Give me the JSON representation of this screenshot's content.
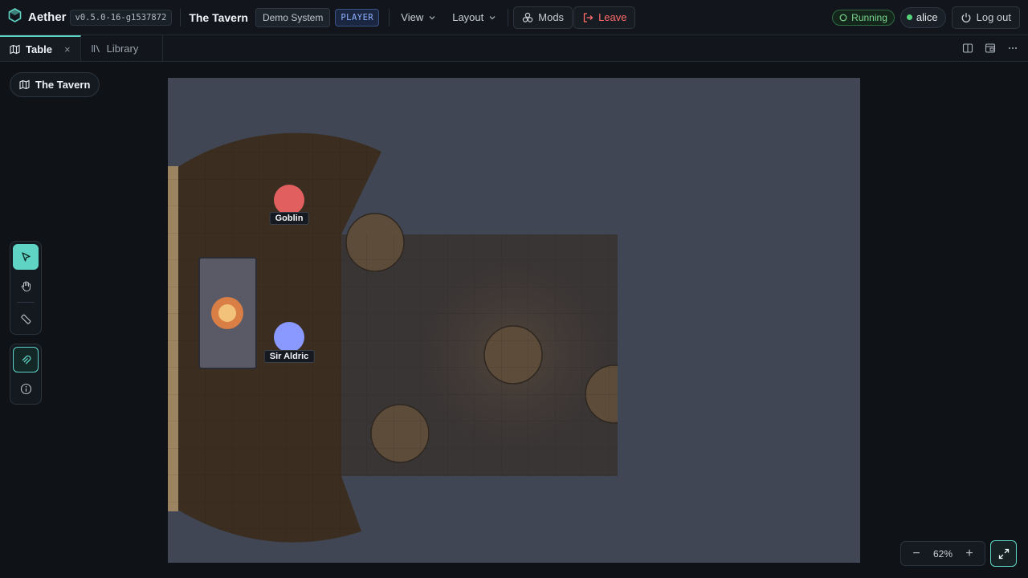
{
  "header": {
    "brand": "Aether",
    "version": "v0.5.0-16-g1537872",
    "table_name": "The Tavern",
    "system": "Demo System",
    "role": "PLAYER",
    "menus": {
      "view": "View",
      "layout": "Layout"
    },
    "mods": "Mods",
    "leave": "Leave",
    "status": "Running",
    "user": "alice",
    "logout": "Log out"
  },
  "tabs": [
    {
      "label": "Table",
      "active": true,
      "icon": "map-icon"
    },
    {
      "label": "Library",
      "active": false,
      "icon": "library-icon"
    }
  ],
  "tab_close": "×",
  "scene": {
    "name": "The Tavern"
  },
  "tools": [
    "select-pointer-icon",
    "pan-hand-icon",
    "measure-ruler-icon",
    "snap-magnet-icon",
    "info-icon"
  ],
  "tokens": [
    {
      "name": "Goblin",
      "color": "#e25f60"
    },
    {
      "name": "Sir Aldric",
      "color": "#8a99ff"
    }
  ],
  "zoom": {
    "minus": "−",
    "value": "62%",
    "plus": "+"
  },
  "colors": {
    "accent": "#5fd4c4",
    "danger": "#ff6a6a",
    "running": "#56d37a",
    "map_bg": "#404654"
  }
}
